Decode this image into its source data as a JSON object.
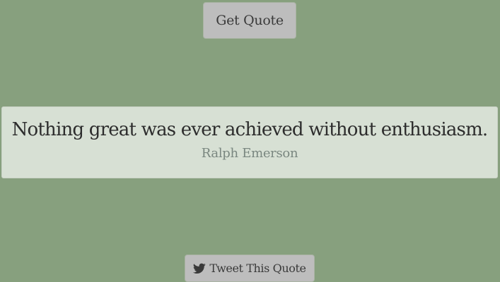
{
  "header": {
    "get_quote_label": "Get Quote"
  },
  "quote": {
    "text": "Nothing great was ever achieved without enthusiasm.",
    "author": "Ralph Emerson"
  },
  "footer": {
    "tweet_label": "Tweet This Quote",
    "tweet_icon": "twitter-icon"
  },
  "colors": {
    "background": "#87a07e",
    "card": "#d7e0d4",
    "button": "#bdbdbd",
    "quote_text": "#2d2d2d",
    "author_text": "#7a8780"
  }
}
